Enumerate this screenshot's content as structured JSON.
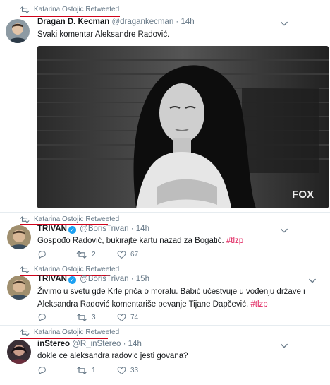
{
  "tweets": [
    {
      "retweeted_by": "Katarina Ostojic Retweeted",
      "name": "Dragan D. Kecman",
      "handle": "@dragankecman",
      "time": "· 14h",
      "text": "Svaki komentar Aleksandre Radović.",
      "media_watermark": "FOX"
    },
    {
      "retweeted_by": "Katarina Ostojic Retweeted",
      "name": "TRIVAN",
      "handle": "@BorisTrivan",
      "time": "· 14h",
      "text": "Gospođo Radović, bukirajte kartu nazad za Bogatić.",
      "hashtag": "#tlzp",
      "retweets": "2",
      "likes": "67"
    },
    {
      "retweeted_by": "Katarina Ostojic Retweeted",
      "name": "TRIVAN",
      "handle": "@BorisTrivan",
      "time": "· 15h",
      "text_line1": "Živimo u svetu gde Krle priča o moralu. Babić učestvuje u vođenju države i",
      "text_line2": "Aleksandra Radović komentariše pevanje Tijane Dapčević.",
      "hashtag": "#tlzp",
      "retweets": "3",
      "likes": "74"
    },
    {
      "retweeted_by": "Katarina Ostojic Retweeted",
      "name": "inStereo",
      "handle": "@R_inStereo",
      "time": "· 14h",
      "text": "dokle ce aleksandra radovic jesti govana?",
      "retweets": "1",
      "likes": "33"
    }
  ],
  "colors": {
    "accent": "#1da1f2",
    "hashtag": "#e0245e",
    "underline": "#d0021b",
    "meta": "#657786"
  }
}
